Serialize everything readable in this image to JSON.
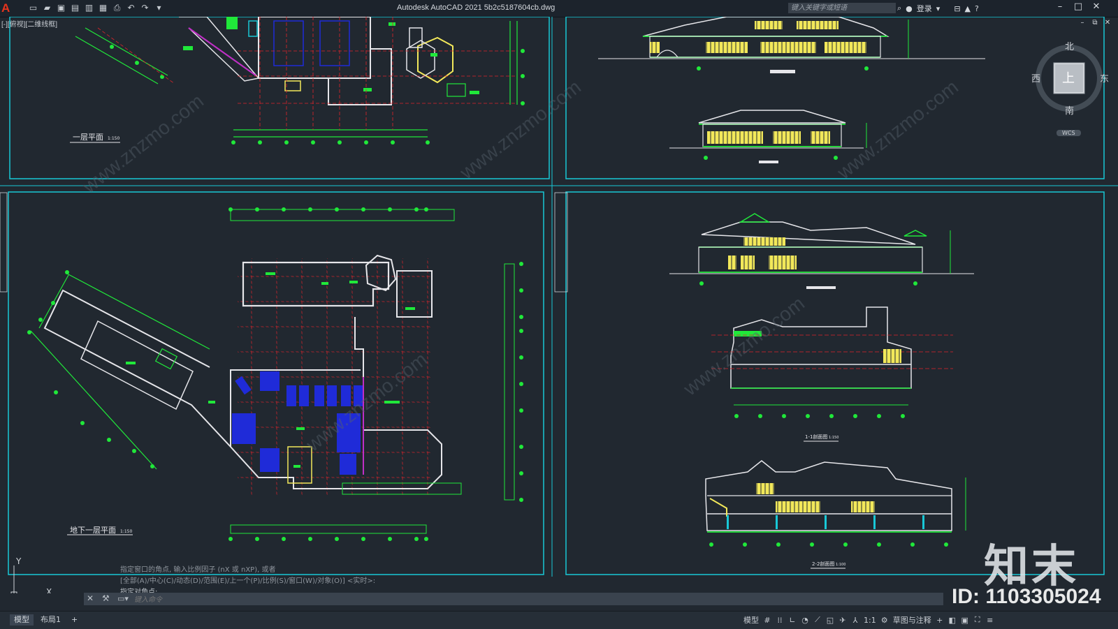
{
  "app": {
    "logo_letter": "A",
    "window_title": "Autodesk AutoCAD 2021    5b2c5187604cb.dwg",
    "search_placeholder": "键入关键字或短语",
    "login_label": "登录",
    "view_label": "[-][俯视][二维线框]"
  },
  "navcube": {
    "north": "北",
    "south": "南",
    "east": "东",
    "west": "西",
    "top_face": "上",
    "wcs": "WCS"
  },
  "viewports": {
    "plan1_title": "一层平面",
    "plan1_scale": "1:150",
    "basement_title": "地下一层平面",
    "basement_scale": "1:150",
    "section1_title": "1-1剖面图",
    "section1_scale": "1:150",
    "section2_title": "2-2剖面图",
    "section2_scale": "1:100"
  },
  "ucs": {
    "x_label": "X",
    "y_label": "Y"
  },
  "command": {
    "history": [
      "指定窗口的角点, 输入比例因子 (nX 或 nXP), 或者",
      "[全部(A)/中心(C)/动态(D)/范围(E)/上一个(P)/比例(S)/窗口(W)/对象(O)] <实时>:",
      "指定对角点:"
    ],
    "placeholder": "键入命令"
  },
  "layout_tabs": [
    "模型",
    "布局1"
  ],
  "status": {
    "model_label": "模型",
    "scale_label": "1:1",
    "workspace_label": "草图与注释"
  },
  "watermark": {
    "brand": "知末",
    "id_text": "ID: 1103305024",
    "site": "www.znzmo.com"
  },
  "colors": {
    "background": "#212830",
    "viewport_border": "#19c8d6",
    "linework_green": "#20e83a",
    "linework_red": "#e0242a",
    "walls": "#e6e6ea",
    "windows": "#f2e85a",
    "parking": "#1f2bd8"
  }
}
